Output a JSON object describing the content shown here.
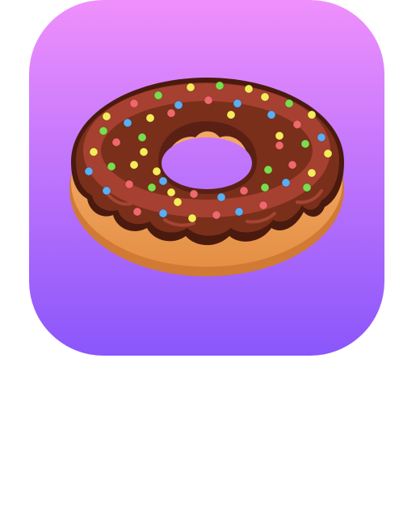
{
  "icon": {
    "name": "donut-icon",
    "gradient_top": "#ef90fc",
    "gradient_bottom": "#8a56fb",
    "dough_color": "#f0a358",
    "dough_shadow": "#d07a35",
    "frosting_dark": "#4a1a0e",
    "frosting_color": "#7a2f1a",
    "frosting_highlight": "#b5473a",
    "sprinkle_colors": [
      "#f6ec5a",
      "#7bdc4e",
      "#5aaef3",
      "#f0686c"
    ]
  }
}
